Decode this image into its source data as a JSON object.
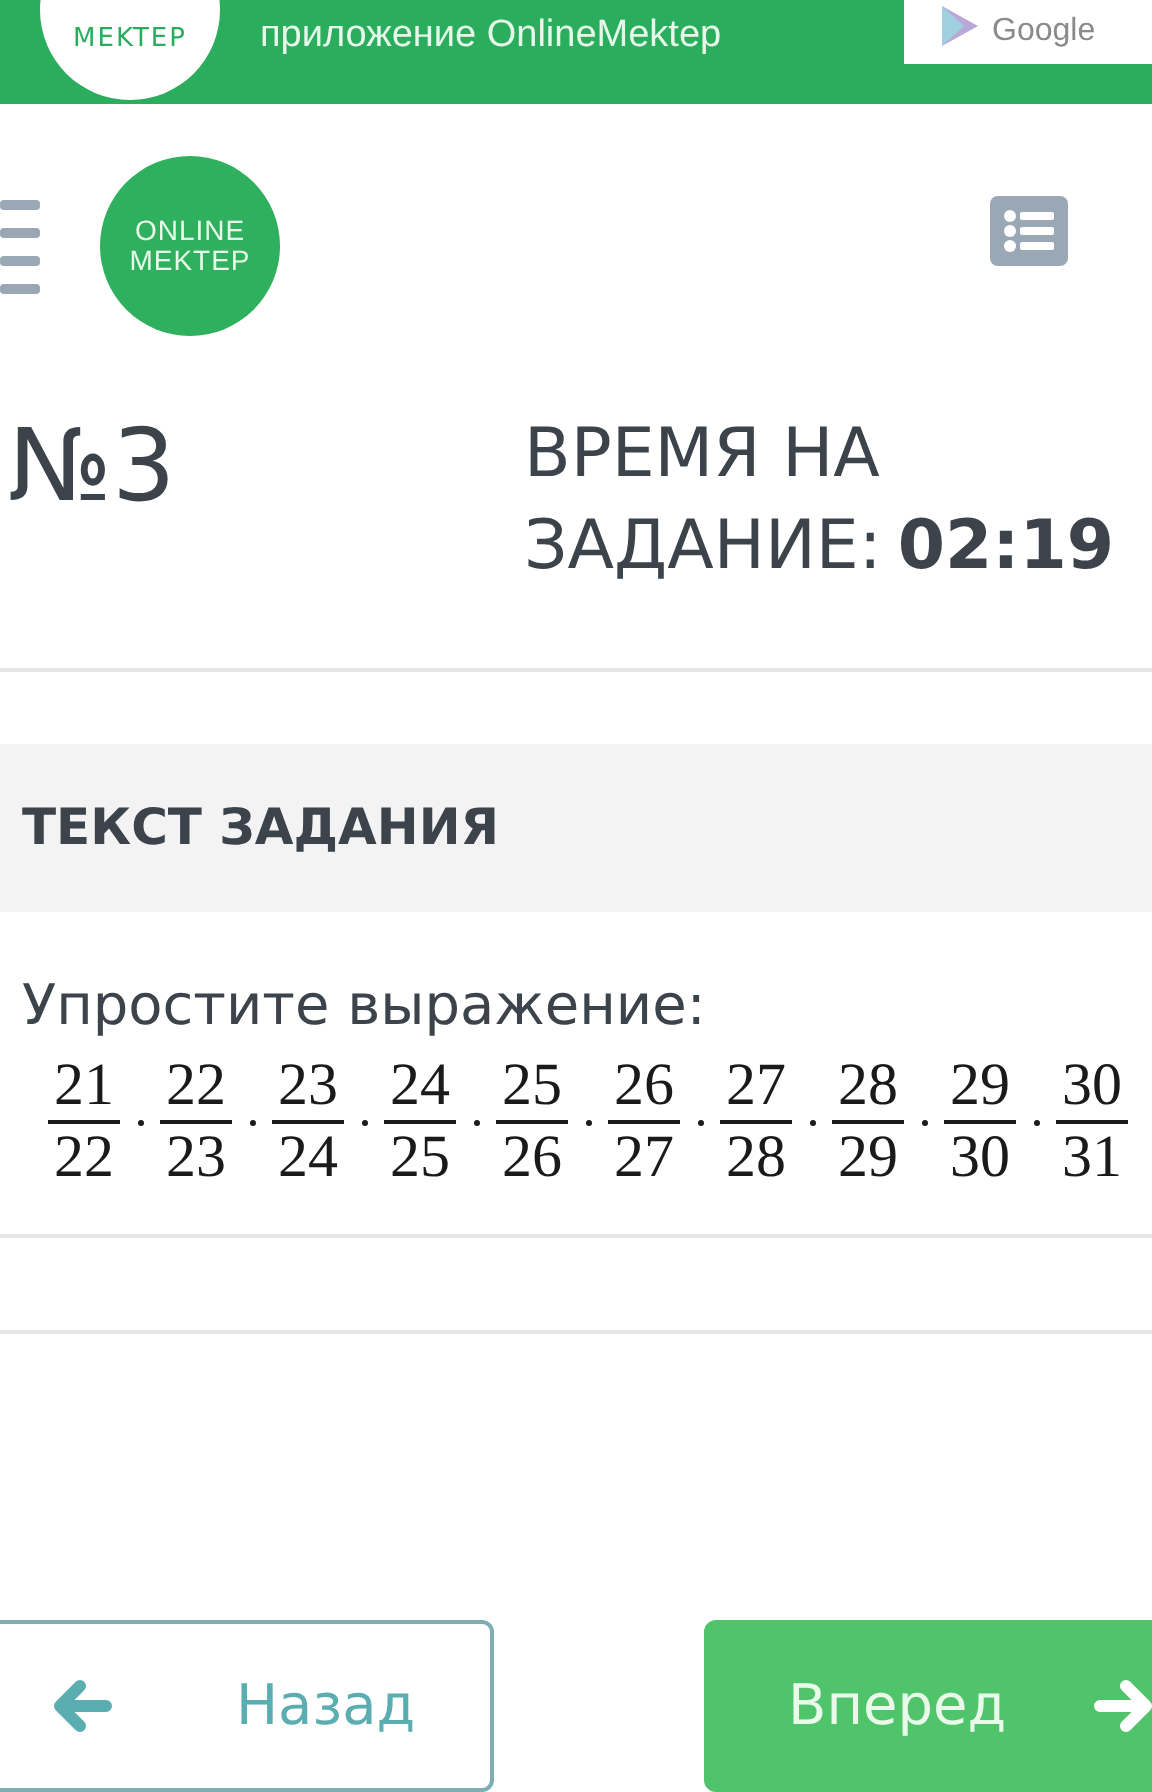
{
  "banner": {
    "logo_text": "MEKTEP",
    "text": "приложение OnlineMektep",
    "store_text": "Google"
  },
  "header": {
    "logo_lines": [
      "ONLINE",
      "MEKTEP"
    ]
  },
  "task": {
    "number": "№3",
    "timer_label_1": "ВРЕМЯ НА",
    "timer_label_2": "ЗАДАНИЕ:",
    "timer_value": "02:19"
  },
  "section_title": "ТЕКСТ ЗАДАНИЯ",
  "question": "Упростите выражение:",
  "fractions": [
    {
      "num": "21",
      "den": "22"
    },
    {
      "num": "22",
      "den": "23"
    },
    {
      "num": "23",
      "den": "24"
    },
    {
      "num": "24",
      "den": "25"
    },
    {
      "num": "25",
      "den": "26"
    },
    {
      "num": "26",
      "den": "27"
    },
    {
      "num": "27",
      "den": "28"
    },
    {
      "num": "28",
      "den": "29"
    },
    {
      "num": "29",
      "den": "30"
    },
    {
      "num": "30",
      "den": "31"
    }
  ],
  "buttons": [
    {
      "kind": "back",
      "label": "Назад"
    },
    {
      "kind": "next",
      "label": "Вперед"
    }
  ]
}
